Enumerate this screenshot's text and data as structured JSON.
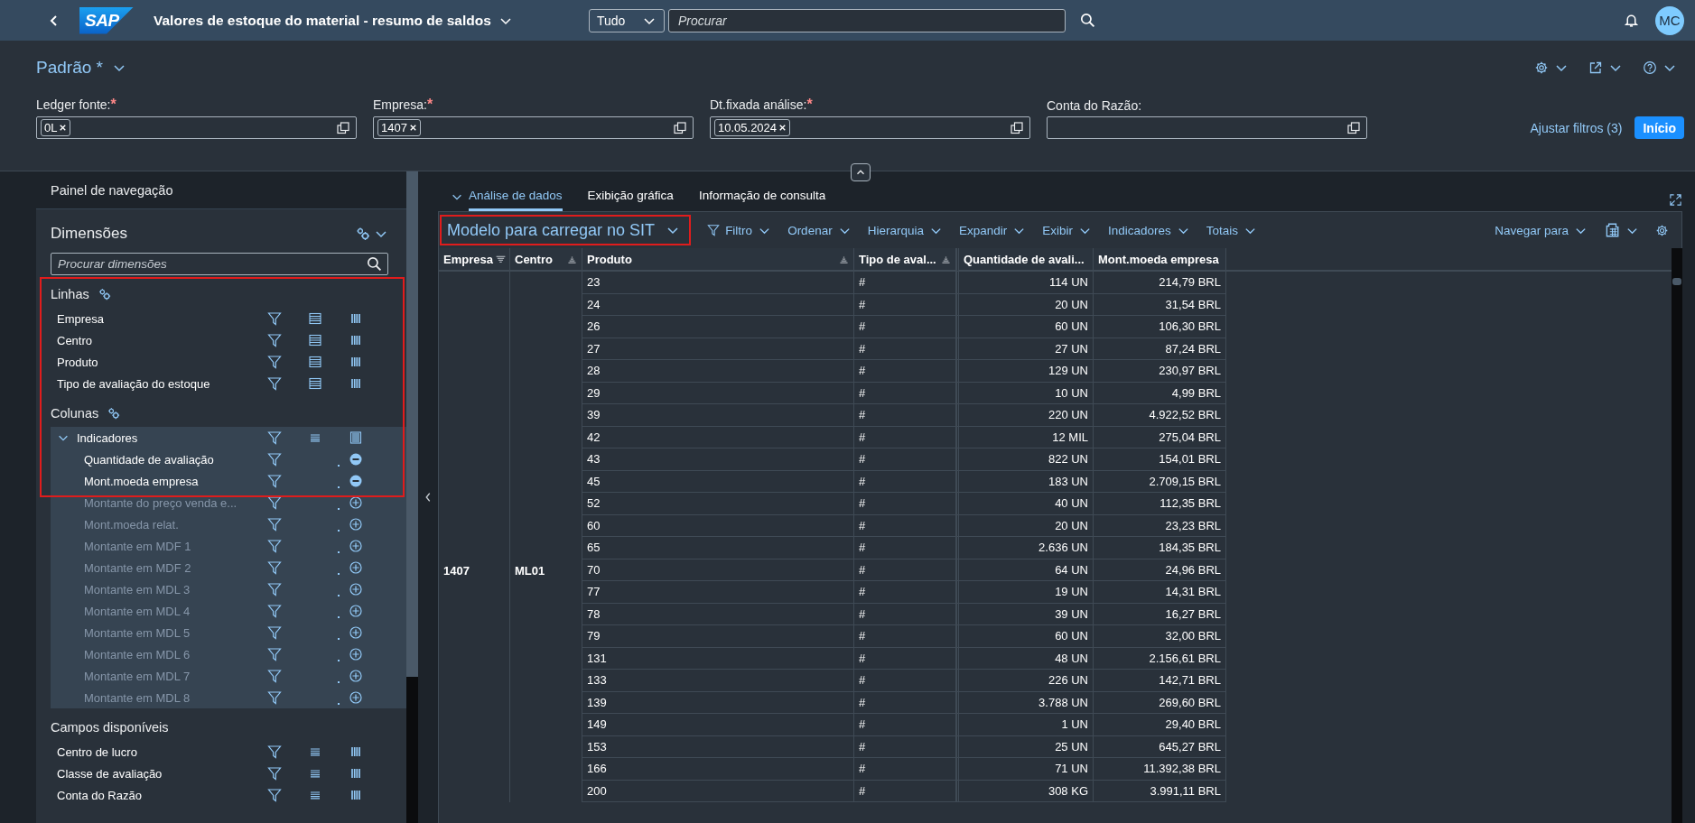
{
  "shell": {
    "logo": "SAP",
    "title": "Valores de estoque do material - resumo de saldos",
    "search_scope": "Tudo",
    "search_placeholder": "Procurar",
    "avatar": "MC"
  },
  "variant": {
    "name": "Padrão *"
  },
  "filters": [
    {
      "label": "Ledger fonte:",
      "required_mark": "*",
      "tokens": [
        "0L"
      ]
    },
    {
      "label": "Empresa:",
      "required_mark": "*",
      "tokens": [
        "1407"
      ]
    },
    {
      "label": "Dt.fixada análise:",
      "required_mark": "*",
      "tokens": [
        "10.05.2024"
      ]
    },
    {
      "label": "Conta do Razão:"
    }
  ],
  "filter_actions": {
    "adjust": "Ajustar filtros (3)",
    "go": "Início"
  },
  "nav_panel": {
    "title": "Painel de navegação",
    "dimensions_title": "Dimensões",
    "search_placeholder": "Procurar dimensões",
    "rows": {
      "title": "Linhas",
      "highlighted": true,
      "items": [
        "Empresa",
        "Centro",
        "Produto",
        "Tipo de avaliação do estoque"
      ]
    },
    "columns": {
      "title": "Colunas",
      "items": [
        {
          "label": "Indicadores",
          "expanded": true,
          "children": [
            {
              "label": "Quantidade de avaliação",
              "active": true,
              "highlighted": true
            },
            {
              "label": "Mont.moeda empresa",
              "active": true,
              "highlighted": true
            },
            {
              "label": "Montante do preço venda e...",
              "active": false,
              "highlighted": false
            },
            {
              "label": "Mont.moeda relat.",
              "active": false,
              "highlighted": false
            },
            {
              "label": "Montante em MDF 1",
              "active": false,
              "highlighted": false
            },
            {
              "label": "Montante em MDF 2",
              "active": false,
              "highlighted": false
            },
            {
              "label": "Montante em MDL 3",
              "active": false,
              "highlighted": false
            },
            {
              "label": "Montante em MDL 4",
              "active": false,
              "highlighted": false
            },
            {
              "label": "Montante em MDL 5",
              "active": false,
              "highlighted": false
            },
            {
              "label": "Montante em MDL 6",
              "active": false,
              "highlighted": false
            },
            {
              "label": "Montante em MDL 7",
              "active": false,
              "highlighted": false
            },
            {
              "label": "Montante em MDL 8",
              "active": false,
              "highlighted": false
            }
          ]
        }
      ]
    },
    "available": {
      "title": "Campos disponíveis",
      "items": [
        "Centro de lucro",
        "Classe de avaliação",
        "Conta do Razão"
      ]
    }
  },
  "tabs": [
    {
      "label": "Análise de dados",
      "selected": true
    },
    {
      "label": "Exibição gráfica",
      "selected": false
    },
    {
      "label": "Informação de consulta",
      "selected": false
    }
  ],
  "toolbar": {
    "view": "Modelo para carregar no SIT",
    "view_highlighted": true,
    "menus": [
      "Filtro",
      "Ordenar",
      "Hierarquia",
      "Expandir",
      "Exibir",
      "Indicadores",
      "Totais"
    ],
    "navigate": "Navegar para"
  },
  "table": {
    "columns": [
      "Empresa",
      "Centro",
      "Produto",
      "Tipo de aval...",
      "Quantidade de avali...",
      "Mont.moeda empresa"
    ],
    "rows": [
      [
        "",
        "",
        "23",
        "#",
        "114 UN",
        "214,79 BRL"
      ],
      [
        "",
        "",
        "24",
        "#",
        "20 UN",
        "31,54 BRL"
      ],
      [
        "",
        "",
        "26",
        "#",
        "60 UN",
        "106,30 BRL"
      ],
      [
        "",
        "",
        "27",
        "#",
        "27 UN",
        "87,24 BRL"
      ],
      [
        "",
        "",
        "28",
        "#",
        "129 UN",
        "230,97 BRL"
      ],
      [
        "",
        "",
        "29",
        "#",
        "10 UN",
        "4,99 BRL"
      ],
      [
        "",
        "",
        "39",
        "#",
        "220 UN",
        "4.922,52 BRL"
      ],
      [
        "",
        "",
        "42",
        "#",
        "12 MIL",
        "275,04 BRL"
      ],
      [
        "",
        "",
        "43",
        "#",
        "822 UN",
        "154,01 BRL"
      ],
      [
        "",
        "",
        "45",
        "#",
        "183 UN",
        "2.709,15 BRL"
      ],
      [
        "",
        "",
        "52",
        "#",
        "40 UN",
        "112,35 BRL"
      ],
      [
        "",
        "",
        "60",
        "#",
        "20 UN",
        "23,23 BRL"
      ],
      [
        "",
        "",
        "65",
        "#",
        "2.636 UN",
        "184,35 BRL"
      ],
      [
        "1407",
        "ML01",
        "70",
        "#",
        "64 UN",
        "24,96 BRL"
      ],
      [
        "",
        "",
        "77",
        "#",
        "19 UN",
        "14,31 BRL"
      ],
      [
        "",
        "",
        "78",
        "#",
        "39 UN",
        "16,27 BRL"
      ],
      [
        "",
        "",
        "79",
        "#",
        "60 UN",
        "32,00 BRL"
      ],
      [
        "",
        "",
        "131",
        "#",
        "48 UN",
        "2.156,61 BRL"
      ],
      [
        "",
        "",
        "133",
        "#",
        "226 UN",
        "142,71 BRL"
      ],
      [
        "",
        "",
        "139",
        "#",
        "3.788 UN",
        "269,60 BRL"
      ],
      [
        "",
        "",
        "149",
        "#",
        "1 UN",
        "29,40 BRL"
      ],
      [
        "",
        "",
        "153",
        "#",
        "25 UN",
        "645,27 BRL"
      ],
      [
        "",
        "",
        "166",
        "#",
        "71 UN",
        "11.392,38 BRL"
      ],
      [
        "",
        "",
        "200",
        "#",
        "308 KG",
        "3.991,11 BRL"
      ]
    ]
  }
}
